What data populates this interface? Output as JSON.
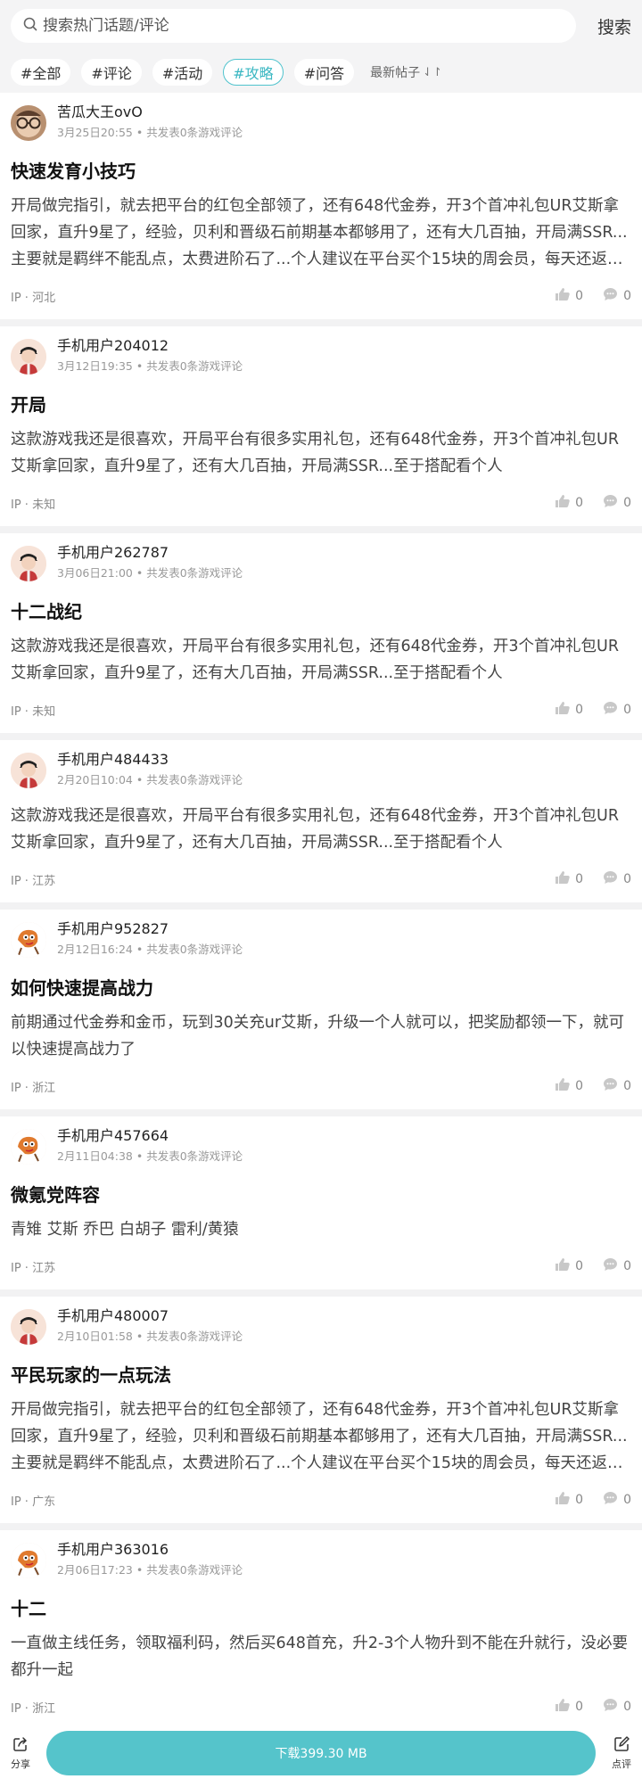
{
  "search": {
    "placeholder": "搜索热门话题/评论",
    "button": "搜索"
  },
  "tags": [
    {
      "label": "#全部",
      "active": false
    },
    {
      "label": "#评论",
      "active": false
    },
    {
      "label": "#活动",
      "active": false
    },
    {
      "label": "#攻略",
      "active": true
    },
    {
      "label": "#问答",
      "active": false
    }
  ],
  "sort": {
    "label": "最新帖子"
  },
  "colors": {
    "accent": "#55c4cb",
    "active_tag": "#3ab7c2"
  },
  "posts": [
    {
      "user": "苦瓜大王ovO",
      "avatar": "glasses-avatar",
      "date": "3月25日20:55",
      "reviews": "共发表0条游戏评论",
      "title": "快速发育小技巧",
      "body": [
        "开局做完指引，就去把平台的红包全部领了，还有648代金券，开3个首冲礼包UR艾斯拿",
        "回家，直升9星了，经验，贝利和晋级石前期基本都够用了，还有大几百抽，开局满SSR...",
        "主要就是羁绊不能乱点，太费进阶石了...个人建议在平台买个15块的周会员，每天还返6..."
      ],
      "ip": "IP · 河北",
      "likes": "0",
      "comments": "0"
    },
    {
      "user": "手机用户204012",
      "avatar": "default-avatar",
      "date": "3月12日19:35",
      "reviews": "共发表0条游戏评论",
      "title": "开局",
      "body": [
        "这款游戏我还是很喜欢，开局平台有很多实用礼包，还有648代金券，开3个首冲礼包UR",
        "艾斯拿回家，直升9星了，还有大几百抽，开局满SSR...至于搭配看个人"
      ],
      "ip": "IP · 未知",
      "likes": "0",
      "comments": "0"
    },
    {
      "user": "手机用户262787",
      "avatar": "default-avatar",
      "date": "3月06日21:00",
      "reviews": "共发表0条游戏评论",
      "title": "十二战纪",
      "body": [
        "这款游戏我还是很喜欢，开局平台有很多实用礼包，还有648代金券，开3个首冲礼包UR",
        "艾斯拿回家，直升9星了，还有大几百抽，开局满SSR...至于搭配看个人"
      ],
      "ip": "IP · 未知",
      "likes": "0",
      "comments": "0"
    },
    {
      "user": "手机用户484433",
      "avatar": "default-avatar",
      "date": "2月20日10:04",
      "reviews": "共发表0条游戏评论",
      "title": "",
      "body": [
        "这款游戏我还是很喜欢，开局平台有很多实用礼包，还有648代金券，开3个首冲礼包UR",
        "艾斯拿回家，直升9星了，还有大几百抽，开局满SSR...至于搭配看个人"
      ],
      "ip": "IP · 江苏",
      "likes": "0",
      "comments": "0"
    },
    {
      "user": "手机用户952827",
      "avatar": "cartoon-avatar",
      "date": "2月12日16:24",
      "reviews": "共发表0条游戏评论",
      "title": "如何快速提高战力",
      "body": [
        "前期通过代金券和金币，玩到30关充ur艾斯，升级一个人就可以，把奖励都领一下，就可",
        "以快速提高战力了"
      ],
      "ip": "IP · 浙江",
      "likes": "0",
      "comments": "0"
    },
    {
      "user": "手机用户457664",
      "avatar": "cartoon-avatar",
      "date": "2月11日04:38",
      "reviews": "共发表0条游戏评论",
      "title": "微氪党阵容",
      "body": [
        "青雉 艾斯 乔巴 白胡子 雷利/黄猿"
      ],
      "ip": "IP · 江苏",
      "likes": "0",
      "comments": "0"
    },
    {
      "user": "手机用户480007",
      "avatar": "default-avatar",
      "date": "2月10日01:58",
      "reviews": "共发表0条游戏评论",
      "title": "平民玩家的一点玩法",
      "body": [
        "开局做完指引，就去把平台的红包全部领了，还有648代金券，开3个首冲礼包UR艾斯拿",
        "回家，直升9星了，经验，贝利和晋级石前期基本都够用了，还有大几百抽，开局满SSR...",
        "主要就是羁绊不能乱点，太费进阶石了...个人建议在平台买个15块的周会员，每天还返6..."
      ],
      "ip": "IP · 广东",
      "likes": "0",
      "comments": "0"
    },
    {
      "user": "手机用户363016",
      "avatar": "cartoon-avatar",
      "date": "2月06日17:23",
      "reviews": "共发表0条游戏评论",
      "title": "十二",
      "body": [
        "一直做主线任务，领取福利码，然后买648首充，升2-3个人物升到不能在升就行，没必要",
        "都升一起"
      ],
      "ip": "IP · 浙江",
      "likes": "0",
      "comments": "0"
    }
  ],
  "bottom": {
    "share": "分享",
    "download": "下载399.30 MB",
    "review": "点评"
  }
}
